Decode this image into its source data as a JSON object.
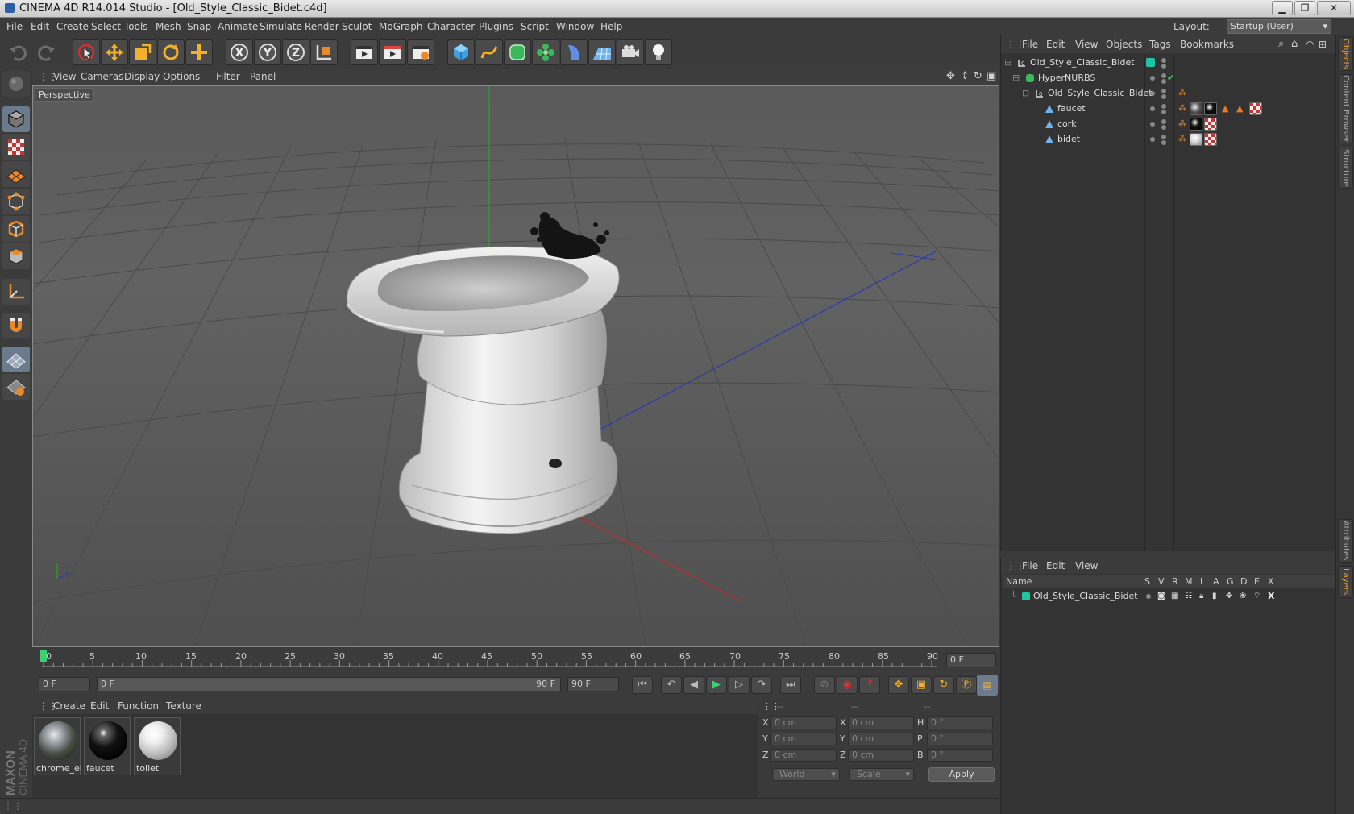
{
  "window": {
    "title": "CINEMA 4D R14.014 Studio - [Old_Style_Classic_Bidet.c4d]"
  },
  "menu": {
    "items": [
      "File",
      "Edit",
      "Create",
      "Select",
      "Tools",
      "Mesh",
      "Snap",
      "Animate",
      "Simulate",
      "Render",
      "Sculpt",
      "MoGraph",
      "Character",
      "Plugins",
      "Script",
      "Window",
      "Help"
    ],
    "layout_label": "Layout:",
    "layout_value": "Startup (User)"
  },
  "toolbar": {
    "icons": [
      "undo-icon",
      "redo-icon",
      "live-selection-icon",
      "move-icon",
      "scale-icon",
      "rotate-icon",
      "add-icon",
      "x-axis-icon",
      "y-axis-icon",
      "z-axis-icon",
      "coordinate-system-icon",
      "render-view-icon",
      "render-picture-viewer-icon",
      "render-settings-icon",
      "cube-icon",
      "spline-icon",
      "nurbs-icon",
      "array-icon",
      "deformer-icon",
      "floor-icon",
      "camera-icon",
      "light-icon"
    ],
    "axis_labels": [
      "X",
      "Y",
      "Z"
    ]
  },
  "left_toolbar": {
    "icons": [
      "make-editable-icon",
      "model-mode-icon",
      "texture-mode-icon",
      "workplane-icon",
      "points-mode-icon",
      "edges-mode-icon",
      "polygons-mode-icon",
      "axis-mode-icon",
      "magnet-icon",
      "snap-grid-icon",
      "snap-lock-icon"
    ]
  },
  "viewport": {
    "menu": [
      "View",
      "Cameras",
      "Display",
      "Options",
      "Filter",
      "Panel"
    ],
    "label": "Perspective"
  },
  "timeline": {
    "ticks": [
      "0",
      "5",
      "10",
      "15",
      "20",
      "25",
      "30",
      "35",
      "40",
      "45",
      "50",
      "55",
      "60",
      "65",
      "70",
      "75",
      "80",
      "85",
      "90"
    ],
    "current_frame": "0 F"
  },
  "transport": {
    "start_field": "0 F",
    "range_start": "0 F",
    "range_end": "90 F",
    "end_field": "90 F"
  },
  "materials": {
    "menu": [
      "Create",
      "Edit",
      "Function",
      "Texture"
    ],
    "items": [
      {
        "name": "chrome_ele"
      },
      {
        "name": "faucet"
      },
      {
        "name": "toilet"
      }
    ]
  },
  "coordinates": {
    "headers": [
      "--",
      "--",
      "--"
    ],
    "rows": [
      {
        "a_label": "X",
        "a": "0 cm",
        "b_label": "X",
        "b": "0 cm",
        "c_label": "H",
        "c": "0 °"
      },
      {
        "a_label": "Y",
        "a": "0 cm",
        "b_label": "Y",
        "b": "0 cm",
        "c_label": "P",
        "c": "0 °"
      },
      {
        "a_label": "Z",
        "a": "0 cm",
        "b_label": "Z",
        "b": "0 cm",
        "c_label": "B",
        "c": "0 °"
      }
    ],
    "space": "World",
    "mode": "Scale",
    "apply": "Apply"
  },
  "objects": {
    "menu": [
      "File",
      "Edit",
      "View",
      "Objects",
      "Tags",
      "Bookmarks"
    ],
    "tree": [
      {
        "name": "Old_Style_Classic_Bidet",
        "icon": "null-object-icon"
      },
      {
        "name": "HyperNURBS",
        "icon": "hypernurbs-icon"
      },
      {
        "name": "Old_Style_Classic_Bidet",
        "icon": "null-object-icon"
      },
      {
        "name": "faucet",
        "icon": "polygon-object-icon"
      },
      {
        "name": "cork",
        "icon": "polygon-object-icon"
      },
      {
        "name": "bidet",
        "icon": "polygon-object-icon"
      }
    ],
    "layer_color": "#1fc5a0"
  },
  "layers": {
    "menu": [
      "File",
      "Edit",
      "View"
    ],
    "columns": [
      "Name",
      "S",
      "V",
      "R",
      "M",
      "L",
      "A",
      "G",
      "D",
      "E",
      "X"
    ],
    "rows": [
      {
        "name": "Old_Style_Classic_Bidet"
      }
    ]
  },
  "side_tabs": [
    "Objects",
    "Content Browser",
    "Structure",
    "Attributes",
    "Layers"
  ],
  "logo": {
    "text": "MAXON CINEMA 4D"
  },
  "colors": {
    "accent": "#f0a030",
    "active_tool": "#6b7a8d",
    "grid_axis_x": "#c03030",
    "grid_axis_y": "#2ea02e",
    "grid_axis_z": "#2a3ab0"
  }
}
